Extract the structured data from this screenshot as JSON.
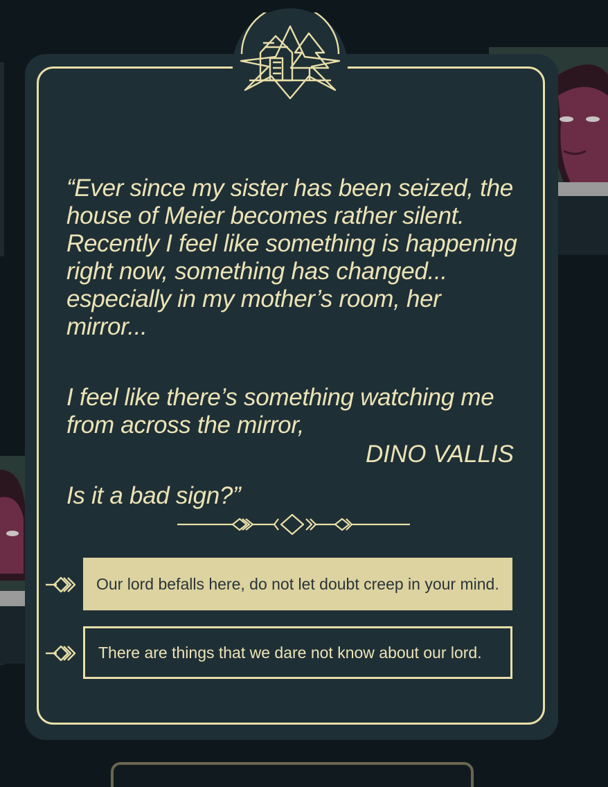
{
  "dialog": {
    "quote_paragraphs": [
      "“Ever since my sister has been seized, the house of Meier becomes rather silent. Recently I feel like something is happening right now, something has changed... especially in my mother’s room, her mirror...",
      "I feel like there’s something watching me from across the mirror,",
      "Is it a bad sign?”"
    ],
    "author": "DINO VALLIS",
    "crest_icon": "house-tree-crest-icon",
    "divider_icon": "ornamental-divider-icon"
  },
  "choices": [
    {
      "label": "Our lord befalls here, do not let doubt creep in your mind.",
      "selected": true
    },
    {
      "label": "There are things that we dare not know about our lord.",
      "selected": false
    }
  ],
  "colors": {
    "panel": "#1f2f36",
    "accent": "#e8dfa8",
    "selected_fill": "#ddd3a0",
    "background": "#0e181c"
  }
}
